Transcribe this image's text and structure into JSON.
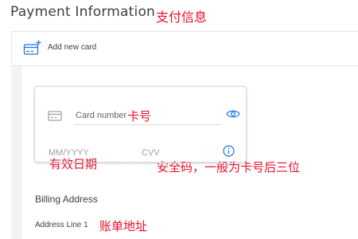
{
  "header": {
    "title": "Payment Information",
    "title_annotation": "支付信息"
  },
  "add_card": {
    "label": "Add new card",
    "icon": "credit-card-add-icon"
  },
  "card_form": {
    "card_number_label": "Card number",
    "card_number_annotation": "卡号",
    "visibility_icon": "eye-icon",
    "expiry_placeholder": "MM/YYYY",
    "expiry_annotation": "有效日期",
    "cvv_placeholder": "CVV",
    "cvv_annotation": "安全码，一般为卡号后三位",
    "cvv_info_icon": "info-icon"
  },
  "billing": {
    "title": "Billing Address",
    "address_line_1_label": "Address Line 1",
    "address_line_1_annotation": "账单地址"
  },
  "colors": {
    "accent": "#1a73e8",
    "annotation": "#e8102a",
    "panel": "#f1f3f4",
    "text": "#3c4043"
  }
}
